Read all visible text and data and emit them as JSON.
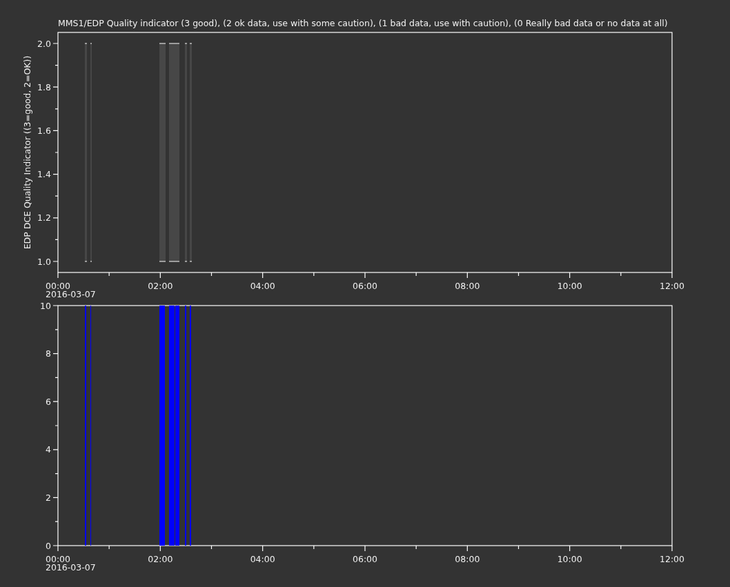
{
  "title": "MMS1/EDP  Quality indicator (3 good), (2 ok data, use with some caution), (1 bad data, use with caution), (0 Really bad data or no data at all)",
  "panels": [
    {
      "kind": "quality-bands",
      "ylabel": "EDP DCE Quality Indicator ((3=good, 2=OK))",
      "yticks": [
        "2.0",
        "1.8",
        "1.6",
        "1.4",
        "1.2",
        "1.0"
      ],
      "xticks": [
        "00:00",
        "02:00",
        "04:00",
        "06:00",
        "08:00",
        "10:00",
        "12:00"
      ],
      "date": "2016-03-07"
    },
    {
      "kind": "blue-bars",
      "yticks": [
        "10",
        "8",
        "6",
        "4",
        "2",
        "0"
      ],
      "xticks": [
        "00:00",
        "02:00",
        "04:00",
        "06:00",
        "08:00",
        "10:00",
        "12:00"
      ],
      "date": "2016-03-07"
    }
  ]
}
